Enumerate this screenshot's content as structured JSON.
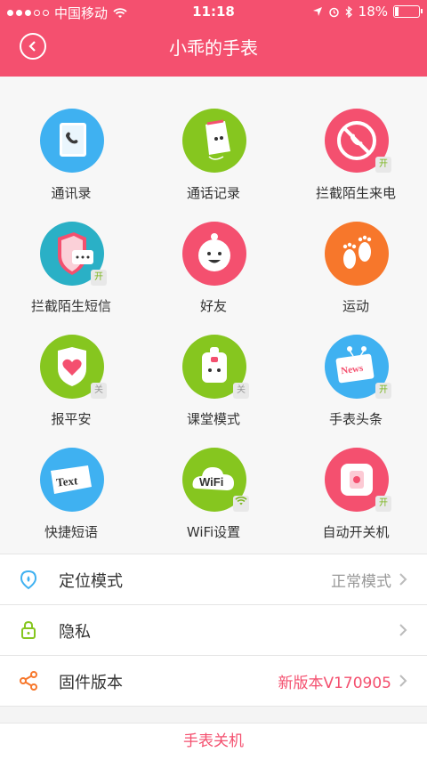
{
  "status_bar": {
    "carrier": "中国移动",
    "time": "11:18",
    "battery": "18%",
    "battery_level": 0.18
  },
  "header": {
    "title": "小乖的手表"
  },
  "grid": [
    {
      "label": "通讯录",
      "icon": "contacts-icon",
      "color": "#3fb1f1",
      "badge": ""
    },
    {
      "label": "通话记录",
      "icon": "call-log-icon",
      "color": "#86c61f",
      "badge": ""
    },
    {
      "label": "拦截陌生来电",
      "icon": "block-call-icon",
      "color": "#f4506f",
      "badge": "开"
    },
    {
      "label": "拦截陌生短信",
      "icon": "block-sms-icon",
      "color": "#2ab0c6",
      "badge": "开"
    },
    {
      "label": "好友",
      "icon": "friends-icon",
      "color": "#f4506f",
      "badge": ""
    },
    {
      "label": "运动",
      "icon": "footprint-icon",
      "color": "#f7772b",
      "badge": ""
    },
    {
      "label": "报平安",
      "icon": "heart-shield-icon",
      "color": "#86c61f",
      "badge": "关"
    },
    {
      "label": "课堂模式",
      "icon": "backpack-icon",
      "color": "#86c61f",
      "badge": "关"
    },
    {
      "label": "手表头条",
      "icon": "news-icon",
      "color": "#3fb1f1",
      "badge": "开"
    },
    {
      "label": "快捷短语",
      "icon": "text-icon",
      "color": "#3fb1f1",
      "badge": ""
    },
    {
      "label": "WiFi设置",
      "icon": "wifi-cloud-icon",
      "color": "#86c61f",
      "badge": "wifi"
    },
    {
      "label": "自动开关机",
      "icon": "power-device-icon",
      "color": "#f4506f",
      "badge": "开"
    }
  ],
  "icon_text": {
    "news": "News",
    "text": "Text",
    "wifi": "WiFi"
  },
  "settings": [
    {
      "label": "定位模式",
      "value": "正常模式",
      "icon": "location-icon",
      "value_color": "#999999"
    },
    {
      "label": "隐私",
      "value": "",
      "icon": "lock-icon",
      "value_color": "#999999"
    },
    {
      "label": "固件版本",
      "value": "新版本V170905",
      "icon": "share-icon",
      "value_color": "#f4506f"
    }
  ],
  "bottom_button": {
    "label": "手表关机"
  },
  "colors": {
    "accent": "#f4506f",
    "green": "#86c61f",
    "blue": "#3fb1f1",
    "orange": "#f7772b"
  }
}
